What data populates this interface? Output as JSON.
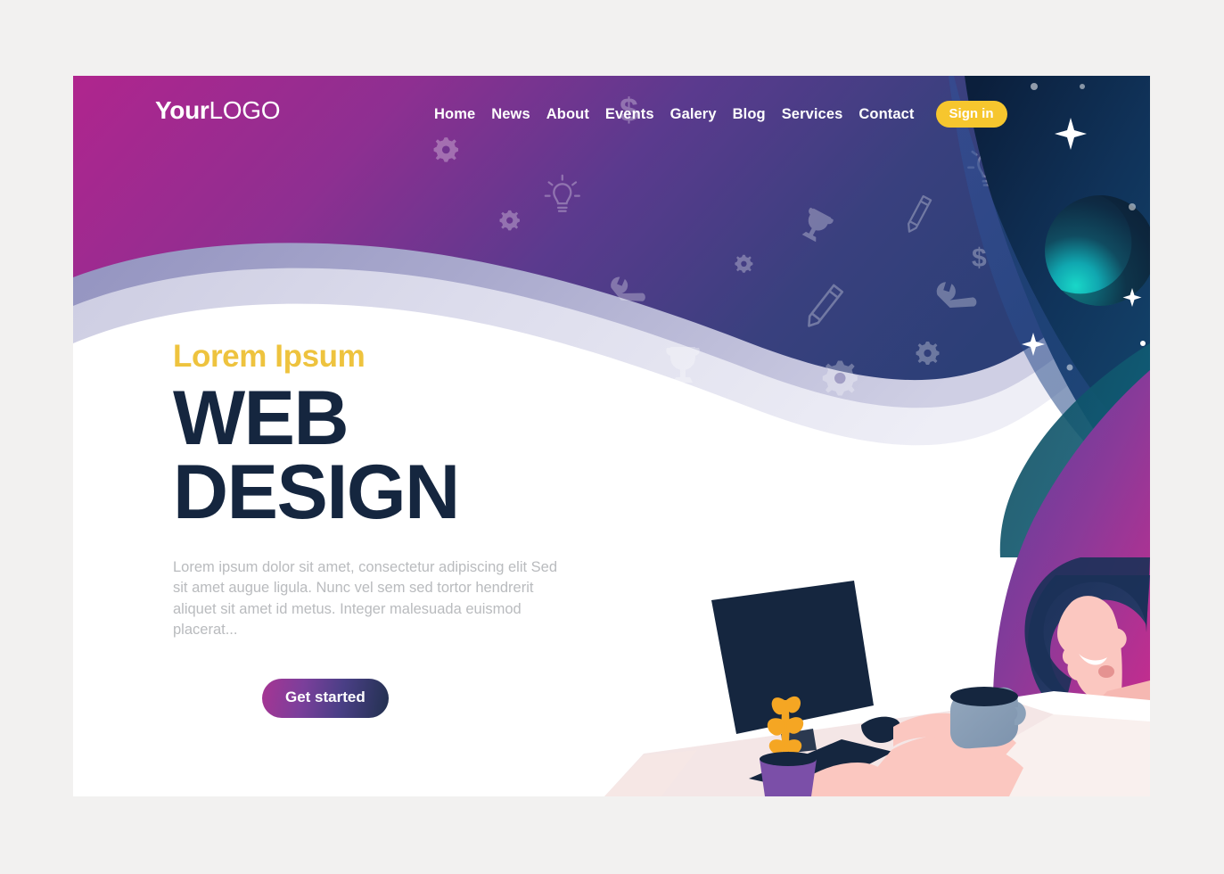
{
  "page": {
    "background_color": "#f2f1f0",
    "card_background": "#ffffff"
  },
  "nav": {
    "logo_bold": "Your",
    "logo_light": "LOGO",
    "items": [
      {
        "label": "Home"
      },
      {
        "label": "News"
      },
      {
        "label": "About"
      },
      {
        "label": "Events"
      },
      {
        "label": "Galery"
      },
      {
        "label": "Blog"
      },
      {
        "label": "Services"
      },
      {
        "label": "Contact"
      }
    ],
    "signin_label": "Sign in",
    "signin_color": "#f6c62e",
    "link_color": "#ffffff"
  },
  "hero": {
    "eyebrow": "Lorem Ipsum",
    "eyebrow_color": "#eec33e",
    "title_line1": "WEB",
    "title_line2": "DESIGN",
    "title_color": "#15263f",
    "paragraph": "Lorem ipsum dolor sit amet, consectetur adipiscing elit Sed sit amet augue ligula. Nunc vel sem sed tortor hendrerit aliquet sit amet id metus. Integer malesuada euismod placerat...",
    "paragraph_color": "#b9bbbe",
    "cta_label": "Get started"
  },
  "decor": {
    "wave_magenta": "#b0258e",
    "wave_purple": "#5b3a8e",
    "wave_navy": "#2c3f77",
    "band_mid": "#9a9ac4",
    "band_light": "#d3d3e8",
    "space_navy": "#0d2340",
    "space_blue": "#2a4b86",
    "planet_dark": "#123044",
    "planet_teal": "#14b9bd",
    "star_color": "#ffffff",
    "icons": [
      "gear-icon",
      "lightbulb-icon",
      "dollar-icon",
      "wrench-icon",
      "pencil-icon",
      "trophy-icon"
    ]
  },
  "illustration": {
    "monitor_color": "#15263f",
    "keyboard_color": "#15263f",
    "mouse_color": "#15263f",
    "mug_color": "#8aa0b8",
    "plant_leaf_color": "#f5a623",
    "pot_color": "#7b4fa8",
    "skin_color": "#fbc7c0",
    "shirt_gradient_start": "#6b3f9e",
    "shirt_gradient_end": "#c92a8d",
    "hair_color": "#1b3158",
    "desk_color": "#ffffff",
    "desk_shadow": "#f0dedd"
  }
}
